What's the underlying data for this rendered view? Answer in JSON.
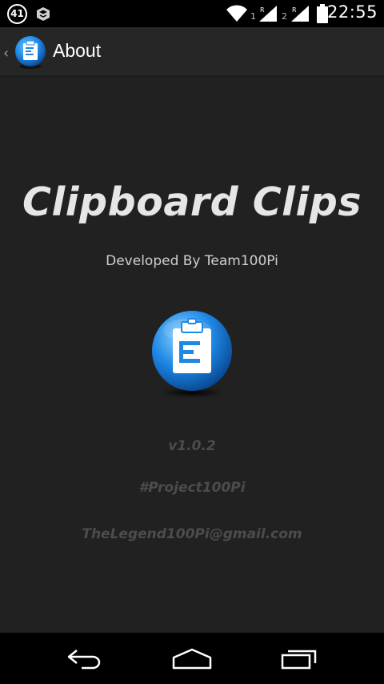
{
  "status_bar": {
    "notification_count": "41",
    "sim1_label": "1",
    "sim2_label": "2",
    "clock": "22:55"
  },
  "action_bar": {
    "title": "About"
  },
  "about": {
    "app_name": "Clipboard Clips",
    "developer": "Developed By Team100Pi",
    "version": "v1.0.2",
    "hashtag": "#Project100Pi",
    "email": "TheLegend100Pi@gmail.com"
  },
  "nav_bar": {
    "buttons": [
      "back",
      "home",
      "recents"
    ]
  },
  "colors": {
    "background": "#212121",
    "action_bar": "#262626",
    "logo_blue": "#1e88e5",
    "muted_text": "#4c4c4c"
  }
}
